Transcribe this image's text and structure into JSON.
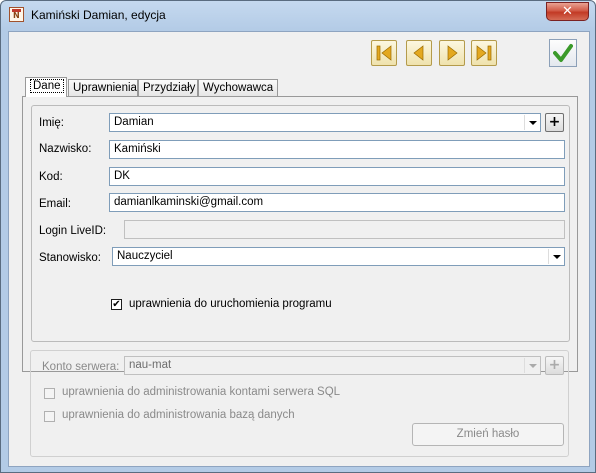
{
  "window": {
    "title": "Kamiński Damian, edycja",
    "close_label": "✕"
  },
  "toolbar": {
    "nav_buttons": [
      "first-icon",
      "prev-icon",
      "next-icon",
      "last-icon"
    ],
    "ok_icon": "checkmark-icon"
  },
  "tabs": [
    {
      "label": "Dane",
      "active": true
    },
    {
      "label": "Uprawnienia"
    },
    {
      "label": "Przydziały"
    },
    {
      "label": "Wychowawca"
    }
  ],
  "form": {
    "imie": {
      "label": "Imię:",
      "value": "Damian"
    },
    "nazwisko": {
      "label": "Nazwisko:",
      "value": "Kamiński"
    },
    "kod": {
      "label": "Kod:",
      "value": "DK"
    },
    "email": {
      "label": "Email:",
      "value": "damianlkaminski@gmail.com"
    },
    "login": {
      "label": "Login LiveID:",
      "value": ""
    },
    "stanowisko": {
      "label": "Stanowisko:",
      "value": "Nauczyciel"
    },
    "uprawnienia_program": {
      "label": "uprawnienia do uruchomienia programu",
      "checked": true
    }
  },
  "server": {
    "konto": {
      "label": "Konto serwera:",
      "value": "nau-mat"
    },
    "admin_kont": {
      "label": "uprawnienia do administrowania kontami serwera SQL",
      "checked": false
    },
    "admin_bazy": {
      "label": "uprawnienia do administrowania bazą danych",
      "checked": false
    },
    "change_password": "Zmień hasło"
  },
  "plus_label": "+",
  "check_mark": "✔",
  "colors": {
    "accent_green": "#3a9a2a",
    "nav_gold": "#e3a820",
    "close_red": "#c23a25"
  }
}
